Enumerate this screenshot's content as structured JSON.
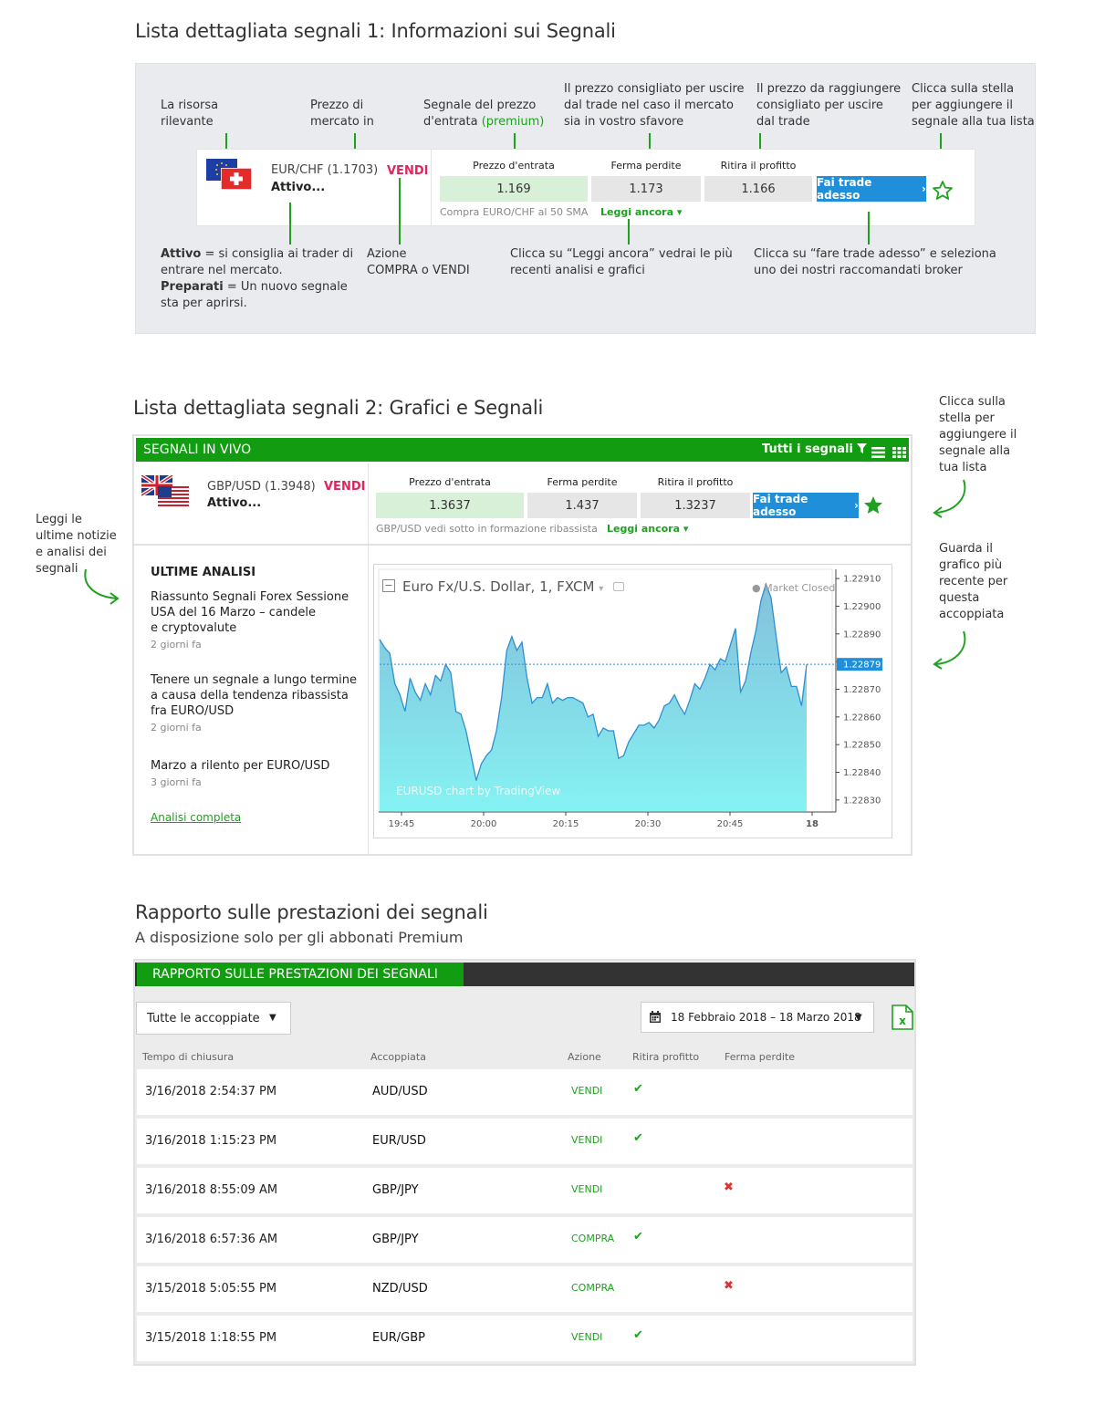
{
  "section1": {
    "title": "Lista dettagliata segnali 1: Informazioni sui Segnali",
    "ann_risorsa": [
      "La risorsa",
      "rilevante"
    ],
    "ann_prezzo_mercato": [
      "Prezzo di",
      "mercato in"
    ],
    "ann_segnale_entrata": [
      "Segnale del prezzo",
      "d'entrata",
      "(premium)"
    ],
    "ann_prezzo_uscire": [
      "Il prezzo consigliato per uscire",
      "dal trade nel caso il mercato",
      "sia in vostro sfavore"
    ],
    "ann_prezzo_raggiungere": [
      "Il prezzo da raggiungere",
      "consigliato per uscire",
      "dal trade"
    ],
    "ann_stella": [
      "Clicca sulla stella",
      "per aggiungere il",
      "segnale alla tua lista"
    ],
    "ann_attivo_bold": "Attivo",
    "ann_attivo_rest": [
      "= si consiglia ai trader di",
      "entrare nel mercato."
    ],
    "ann_preparati_bold": "Preparati",
    "ann_preparati_rest": [
      "= Un nuovo segnale",
      "sta per aprirsi."
    ],
    "ann_azione": [
      "Azione",
      "COMPRA o VENDI"
    ],
    "ann_leggi": [
      "Clicca su “Leggi ancora” vedrai le più",
      "recenti analisi e grafici"
    ],
    "ann_fare_trade": [
      "Clicca su “fare trade adesso” e seleziona",
      "uno dei nostri raccomandati broker"
    ],
    "card": {
      "pair": "EUR/CHF (1.1703)",
      "status": "Attivo...",
      "action": "VENDI",
      "entry_label": "Prezzo d'entrata",
      "entry_value": "1.169",
      "stop_label": "Ferma perdite",
      "stop_value": "1.173",
      "profit_label": "Ritira il profitto",
      "profit_value": "1.166",
      "trade_button": "Fai trade adesso",
      "note": "Compra EURO/CHF al 50 SMA",
      "leggi": "Leggi ancora"
    }
  },
  "section2": {
    "title": "Lista dettagliata segnali 2: Grafici e Segnali",
    "ann_stella": [
      "Clicca sulla",
      "stella per",
      "aggiungere il",
      "segnale alla",
      "tua lista"
    ],
    "ann_grafico": [
      "Guarda il",
      "grafico più",
      "recente per",
      "questa",
      "accoppiata"
    ],
    "ann_notizie": [
      "Leggi le",
      "ultime notizie",
      "e analisi dei",
      "segnali"
    ],
    "bar_title": "SEGNALI IN VIVO",
    "bar_filter": "Tutti i segnali",
    "card": {
      "pair": "GBP/USD (1.3948)",
      "status": "Attivo...",
      "action": "VENDI",
      "entry_label": "Prezzo d'entrata",
      "entry_value": "1.3637",
      "stop_label": "Ferma perdite",
      "stop_value": "1.437",
      "profit_label": "Ritira il profitto",
      "profit_value": "1.3237",
      "trade_button": "Fai trade adesso",
      "note": "GBP/USD vedi sotto in formazione ribassista",
      "leggi": "Leggi ancora"
    },
    "analisi": {
      "title": "ULTIME ANALISI",
      "items": [
        {
          "lines": [
            "Riassunto Segnali Forex Sessione",
            "USA del 16 Marzo – candele",
            "e cryptovalute"
          ],
          "date": "2 giorni fa"
        },
        {
          "lines": [
            "Tenere un segnale a lungo termine",
            "a causa della tendenza ribassista",
            "fra EURO/USD"
          ],
          "date": "2 giorni fa"
        },
        {
          "lines": [
            "Marzo a rilento per EURO/USD"
          ],
          "date": "3 giorni fa"
        }
      ],
      "link": "Analisi completa"
    },
    "chart_header": "Euro Fx/U.S. Dollar, 1, FXCM",
    "market_closed": "Market Closed",
    "watermark": "EURUSD chart by TradingView",
    "current_price": "1.22879"
  },
  "chart_data": {
    "type": "area",
    "title": "Euro Fx/U.S. Dollar, 1, FXCM",
    "x_ticks": [
      "19:45",
      "20:00",
      "20:15",
      "20:30",
      "20:45",
      "18"
    ],
    "y_ticks": [
      "1.22910",
      "1.22900",
      "1.22890",
      "1.22880",
      "1.22870",
      "1.22860",
      "1.22850",
      "1.22840",
      "1.22830"
    ],
    "ylim": [
      1.22826,
      1.22913
    ],
    "values": [
      1.22888,
      1.22885,
      1.22883,
      1.22872,
      1.22868,
      1.22862,
      1.22874,
      1.22869,
      1.22866,
      1.22872,
      1.22868,
      1.22875,
      1.22873,
      1.22879,
      1.22876,
      1.22862,
      1.22861,
      1.22855,
      1.22846,
      1.22837,
      1.22843,
      1.22846,
      1.22848,
      1.22855,
      1.22867,
      1.22884,
      1.22889,
      1.22884,
      1.22887,
      1.22874,
      1.22865,
      1.22867,
      1.22867,
      1.22872,
      1.22865,
      1.22867,
      1.22866,
      1.22867,
      1.22867,
      1.22866,
      1.22865,
      1.2286,
      1.22861,
      1.22853,
      1.22856,
      1.22855,
      1.22855,
      1.22845,
      1.22846,
      1.22851,
      1.22854,
      1.22857,
      1.22857,
      1.22858,
      1.22856,
      1.22859,
      1.22864,
      1.22865,
      1.22868,
      1.22864,
      1.22861,
      1.22866,
      1.22872,
      1.2287,
      1.22874,
      1.22879,
      1.22877,
      1.22881,
      1.2288,
      1.22886,
      1.22892,
      1.22869,
      1.22873,
      1.22883,
      1.22891,
      1.22902,
      1.22908,
      1.22903,
      1.22889,
      1.22876,
      1.22878,
      1.22871,
      1.22871,
      1.22864,
      1.22879
    ],
    "xlabel": "",
    "ylabel": ""
  },
  "section3": {
    "title": "Rapporto sulle prestazioni dei segnali",
    "subtitle": "A disposizione solo per gli abbonati Premium",
    "bar_title": "RAPPORTO SULLE PRESTAZIONI DEI SEGNALI",
    "pair_select": "Tutte le accoppiate",
    "date_range": "18 Febbraio 2018 – 18 Marzo 2018",
    "columns": [
      "Tempo di chiusura",
      "Accoppiata",
      "Azione",
      "Ritira profitto",
      "Ferma perdite"
    ],
    "rows": [
      {
        "time": "3/16/2018 2:54:37 PM",
        "pair": "AUD/USD",
        "action": "VENDI",
        "profit": "✔",
        "stop": ""
      },
      {
        "time": "3/16/2018 1:15:23 PM",
        "pair": "EUR/USD",
        "action": "VENDI",
        "profit": "✔",
        "stop": ""
      },
      {
        "time": "3/16/2018 8:55:09 AM",
        "pair": "GBP/JPY",
        "action": "VENDI",
        "profit": "",
        "stop": "✖"
      },
      {
        "time": "3/16/2018 6:57:36 AM",
        "pair": "GBP/JPY",
        "action": "COMPRA",
        "profit": "✔",
        "stop": ""
      },
      {
        "time": "3/15/2018 5:05:55 PM",
        "pair": "NZD/USD",
        "action": "COMPRA",
        "profit": "",
        "stop": "✖"
      },
      {
        "time": "3/15/2018 1:18:55 PM",
        "pair": "EUR/GBP",
        "action": "VENDI",
        "profit": "✔",
        "stop": ""
      }
    ]
  },
  "colors": {
    "brand_green": "#129c11",
    "accent_green": "#1ea11e",
    "blue_button": "#1e8fd8",
    "sell_red": "#e0245e"
  }
}
